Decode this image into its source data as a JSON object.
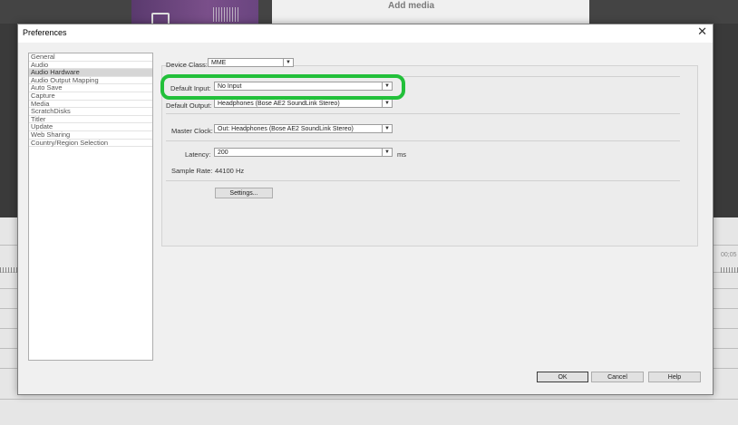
{
  "background": {
    "add_media_label": "Add media",
    "timecode": "00;05"
  },
  "dialog": {
    "title": "Preferences",
    "close_glyph": "✕"
  },
  "categories": [
    {
      "label": "General",
      "selected": false
    },
    {
      "label": "Audio",
      "selected": false
    },
    {
      "label": "Audio Hardware",
      "selected": true
    },
    {
      "label": "Audio Output Mapping",
      "selected": false
    },
    {
      "label": "Auto Save",
      "selected": false
    },
    {
      "label": "Capture",
      "selected": false
    },
    {
      "label": "Media",
      "selected": false
    },
    {
      "label": "ScratchDisks",
      "selected": false
    },
    {
      "label": "Titler",
      "selected": false
    },
    {
      "label": "Update",
      "selected": false
    },
    {
      "label": "Web Sharing",
      "selected": false
    },
    {
      "label": "Country/Region Selection",
      "selected": false
    }
  ],
  "audio_hardware": {
    "device_class_label": "Device Class:",
    "device_class_value": "MME",
    "default_input_label": "Default Input:",
    "default_input_value": "No Input",
    "default_output_label": "Default Output:",
    "default_output_value": "Headphones (Bose AE2 SoundLink Stereo)",
    "master_clock_label": "Master Clock:",
    "master_clock_value": "Out: Headphones (Bose AE2 SoundLink Stereo)",
    "latency_label": "Latency:",
    "latency_value": "200",
    "latency_unit": "ms",
    "sample_rate_label": "Sample Rate:",
    "sample_rate_value": "44100 Hz",
    "settings_button": "Settings..."
  },
  "footer": {
    "ok": "OK",
    "cancel": "Cancel",
    "help": "Help"
  },
  "highlight_color": "#22c03a",
  "dropdown_arrow": "▼"
}
